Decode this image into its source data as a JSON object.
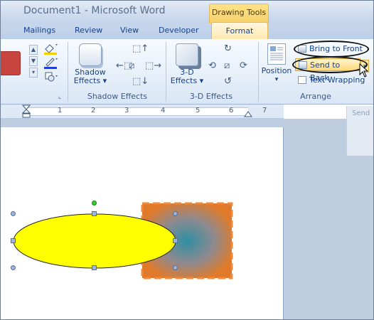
{
  "window": {
    "title": "Document1 - Microsoft Word",
    "contextual_tab": "Drawing Tools"
  },
  "tabs": [
    "Mailings",
    "Review",
    "View",
    "Developer"
  ],
  "active_tab": "Format",
  "ribbon": {
    "groups": {
      "shadow": {
        "button_line1": "Shadow",
        "button_line2": "Effects",
        "footer": "Shadow Effects"
      },
      "threed": {
        "button_line1": "3-D",
        "button_line2": "Effects",
        "footer": "3-D Effects"
      },
      "arrange": {
        "position_label": "Position",
        "bring_to_front": "Bring to Front",
        "send_to_back": "Send to Back",
        "text_wrapping": "Text Wrapping",
        "footer": "Arrange"
      }
    }
  },
  "ruler": {
    "numbers": [
      "1",
      "2",
      "3",
      "4",
      "5",
      "6",
      "7"
    ]
  },
  "side_panel": {
    "title": "Send"
  },
  "colors": {
    "ellipse_fill": "#ffff00",
    "square_outer": "#e07a2a",
    "square_inner": "#2f8ea3"
  }
}
